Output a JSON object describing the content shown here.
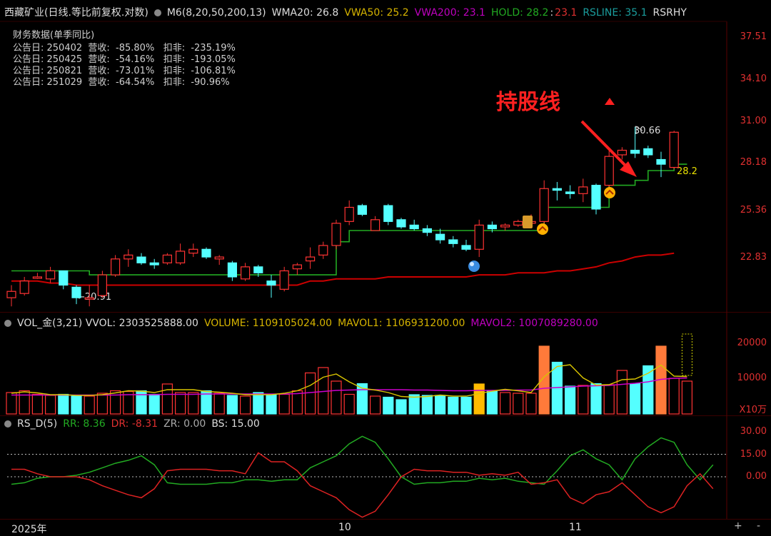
{
  "header": {
    "title": "西藏矿业(日线.等比前复权.对数)",
    "ma_label": "M6(8,20,50,200,13)",
    "wma20": "WMA20: 26.8",
    "vwa50": "VWA50: 25.2",
    "vwa200": "VWA200: 23.1",
    "hold_label": "HOLD: 28.2",
    "hold_sep": ":",
    "hold_low": "23.1",
    "rsline": "RSLINE: 35.1",
    "rsrhy": "RSRHY"
  },
  "financial": {
    "title": "财务数据(单季同比)",
    "rows": [
      "公告日: 250402  营收:  -85.80%   扣非:  -235.19%",
      "公告日: 250425  营收:  -54.16%   扣非:  -193.05%",
      "公告日: 250821  营收:  -73.01%   扣非:  -106.81%",
      "公告日: 251029  营收:  -64.54%   扣非:  -90.96%"
    ]
  },
  "annotation": {
    "text": "持股线",
    "high_label": "30.66",
    "low_label": "←20.91",
    "hold_value": "28.2"
  },
  "price_axis": [
    "37.51",
    "34.10",
    "31.00",
    "28.18",
    "25.36",
    "22.83"
  ],
  "volume": {
    "header": "VOL_金(3,21)  VVOL: 2303525888.00",
    "volume_label": "VOLUME: 1109105024.00",
    "mavol1": "MAVOL1: 1106931200.00",
    "mavol2": "MAVOL2: 1007089280.00",
    "axis": [
      "20000",
      "10000"
    ],
    "unit": "X10万"
  },
  "rs": {
    "header": "RS_D(5)",
    "rr": "RR: 8.36",
    "dr": "DR: -8.31",
    "zr": "ZR: 0.00",
    "bs": "BS: 15.00",
    "axis": [
      "30.00",
      "15.00",
      "0.00"
    ]
  },
  "time_axis": {
    "year": "2025年",
    "m10": "10",
    "m11": "11"
  },
  "controls": {
    "plus": "+",
    "minus": "-"
  },
  "colors": {
    "up": "#ff3333",
    "down": "#54ffff",
    "hold": "#22aa22",
    "vwa200": "#cc0000",
    "mavol2": "#cc00cc",
    "mavol1": "#d9c400",
    "rr": "#22aa22",
    "dr": "#dd2222"
  },
  "chart_data": {
    "type": "candlestick",
    "candles": [
      {
        "o": 20.9,
        "h": 21.5,
        "l": 20.5,
        "c": 21.2,
        "up": true
      },
      {
        "o": 21.1,
        "h": 21.9,
        "l": 21.0,
        "c": 21.7,
        "up": true
      },
      {
        "o": 21.9,
        "h": 22.1,
        "l": 21.8,
        "c": 21.9,
        "up": true
      },
      {
        "o": 21.8,
        "h": 22.4,
        "l": 21.6,
        "c": 22.2,
        "up": true
      },
      {
        "o": 22.2,
        "h": 22.2,
        "l": 21.3,
        "c": 21.5,
        "up": false
      },
      {
        "o": 21.4,
        "h": 21.5,
        "l": 20.6,
        "c": 20.9,
        "up": false
      },
      {
        "o": 20.9,
        "h": 21.5,
        "l": 20.5,
        "c": 20.9,
        "up": true
      },
      {
        "o": 21.0,
        "h": 22.2,
        "l": 20.9,
        "c": 22.0,
        "up": true
      },
      {
        "o": 22.0,
        "h": 23.0,
        "l": 21.9,
        "c": 22.8,
        "up": true
      },
      {
        "o": 22.8,
        "h": 23.3,
        "l": 22.4,
        "c": 23.0,
        "up": true
      },
      {
        "o": 22.9,
        "h": 23.1,
        "l": 22.5,
        "c": 22.6,
        "up": false
      },
      {
        "o": 22.6,
        "h": 22.8,
        "l": 22.3,
        "c": 22.5,
        "up": false
      },
      {
        "o": 22.6,
        "h": 23.1,
        "l": 22.5,
        "c": 23.0,
        "up": true
      },
      {
        "o": 22.6,
        "h": 23.6,
        "l": 22.5,
        "c": 23.2,
        "up": true
      },
      {
        "o": 23.3,
        "h": 23.6,
        "l": 22.9,
        "c": 23.1,
        "up": true
      },
      {
        "o": 23.3,
        "h": 23.4,
        "l": 22.8,
        "c": 22.9,
        "up": false
      },
      {
        "o": 22.8,
        "h": 23.0,
        "l": 22.5,
        "c": 22.9,
        "up": true
      },
      {
        "o": 22.6,
        "h": 22.7,
        "l": 21.7,
        "c": 21.9,
        "up": false
      },
      {
        "o": 21.8,
        "h": 22.6,
        "l": 21.7,
        "c": 22.4,
        "up": true
      },
      {
        "o": 22.4,
        "h": 22.5,
        "l": 21.9,
        "c": 22.1,
        "up": false
      },
      {
        "o": 21.7,
        "h": 22.0,
        "l": 20.9,
        "c": 21.5,
        "up": false
      },
      {
        "o": 21.3,
        "h": 22.4,
        "l": 21.2,
        "c": 22.2,
        "up": true
      },
      {
        "o": 22.3,
        "h": 22.6,
        "l": 22.0,
        "c": 22.5,
        "up": true
      },
      {
        "o": 22.7,
        "h": 23.4,
        "l": 22.3,
        "c": 22.9,
        "up": true
      },
      {
        "o": 23.0,
        "h": 23.7,
        "l": 22.8,
        "c": 23.5,
        "up": true
      },
      {
        "o": 23.5,
        "h": 24.9,
        "l": 23.3,
        "c": 24.7,
        "up": true
      },
      {
        "o": 24.8,
        "h": 26.0,
        "l": 24.6,
        "c": 25.6,
        "up": true
      },
      {
        "o": 25.7,
        "h": 25.8,
        "l": 25.1,
        "c": 25.2,
        "up": false
      },
      {
        "o": 24.3,
        "h": 25.1,
        "l": 24.3,
        "c": 24.9,
        "up": true
      },
      {
        "o": 25.7,
        "h": 25.8,
        "l": 24.6,
        "c": 24.8,
        "up": false
      },
      {
        "o": 24.9,
        "h": 25.0,
        "l": 24.4,
        "c": 24.5,
        "up": false
      },
      {
        "o": 24.6,
        "h": 24.9,
        "l": 24.3,
        "c": 24.4,
        "up": false
      },
      {
        "o": 24.4,
        "h": 24.6,
        "l": 24.0,
        "c": 24.2,
        "up": false
      },
      {
        "o": 24.1,
        "h": 24.4,
        "l": 23.6,
        "c": 23.8,
        "up": false
      },
      {
        "o": 23.8,
        "h": 24.0,
        "l": 23.4,
        "c": 23.6,
        "up": false
      },
      {
        "o": 23.5,
        "h": 23.8,
        "l": 23.2,
        "c": 23.3,
        "up": false
      },
      {
        "o": 23.3,
        "h": 24.9,
        "l": 22.9,
        "c": 24.6,
        "up": true
      },
      {
        "o": 24.4,
        "h": 24.8,
        "l": 24.2,
        "c": 24.6,
        "up": false
      },
      {
        "o": 24.5,
        "h": 24.7,
        "l": 24.3,
        "c": 24.6,
        "up": true
      },
      {
        "o": 24.6,
        "h": 24.9,
        "l": 24.5,
        "c": 24.8,
        "up": true
      },
      {
        "o": 24.8,
        "h": 25.2,
        "l": 24.5,
        "c": 24.7,
        "up": true
      },
      {
        "o": 24.8,
        "h": 27.2,
        "l": 24.6,
        "c": 26.7,
        "up": true
      },
      {
        "o": 26.6,
        "h": 27.1,
        "l": 26.0,
        "c": 26.7,
        "up": false
      },
      {
        "o": 26.4,
        "h": 26.9,
        "l": 26.1,
        "c": 26.5,
        "up": false
      },
      {
        "o": 26.4,
        "h": 27.3,
        "l": 25.9,
        "c": 26.8,
        "up": true
      },
      {
        "o": 26.9,
        "h": 27.0,
        "l": 25.2,
        "c": 25.5,
        "up": false
      },
      {
        "o": 26.9,
        "h": 29.1,
        "l": 26.6,
        "c": 28.7,
        "up": true
      },
      {
        "o": 29.1,
        "h": 29.3,
        "l": 28.5,
        "c": 28.8,
        "up": true
      },
      {
        "o": 28.9,
        "h": 30.66,
        "l": 28.6,
        "c": 29.1,
        "up": false
      },
      {
        "o": 29.2,
        "h": 29.4,
        "l": 28.6,
        "c": 28.8,
        "up": false
      },
      {
        "o": 28.5,
        "h": 29.0,
        "l": 27.4,
        "c": 28.2,
        "up": false
      },
      {
        "o": 28.0,
        "h": 30.4,
        "l": 27.9,
        "c": 30.3,
        "up": true
      }
    ],
    "hold_line": [
      22.2,
      22.2,
      22.2,
      22.2,
      22.2,
      22.2,
      22.0,
      22.0,
      22.0,
      22.0,
      22.0,
      22.0,
      22.0,
      22.0,
      22.0,
      22.0,
      22.0,
      22.0,
      22.0,
      22.0,
      22.0,
      22.0,
      22.0,
      22.0,
      22.0,
      23.7,
      24.3,
      24.3,
      24.3,
      24.3,
      24.3,
      24.3,
      24.3,
      24.3,
      24.3,
      24.3,
      24.3,
      24.3,
      24.3,
      24.3,
      24.3,
      25.6,
      25.6,
      25.6,
      25.6,
      25.6,
      26.9,
      26.9,
      27.2,
      27.8,
      27.8,
      28.2
    ],
    "vwa200": [
      21.7,
      21.7,
      21.7,
      21.6,
      21.6,
      21.5,
      21.5,
      21.5,
      21.5,
      21.5,
      21.5,
      21.5,
      21.5,
      21.5,
      21.5,
      21.5,
      21.5,
      21.5,
      21.5,
      21.5,
      21.5,
      21.5,
      21.5,
      21.7,
      21.7,
      21.8,
      21.8,
      21.8,
      21.8,
      21.9,
      21.9,
      21.9,
      21.9,
      21.9,
      21.9,
      21.9,
      22.0,
      22.0,
      22.0,
      22.1,
      22.1,
      22.1,
      22.2,
      22.2,
      22.3,
      22.4,
      22.6,
      22.7,
      22.9,
      23.0,
      23.0,
      23.1
    ],
    "volume": [
      6000,
      6500,
      5500,
      5200,
      5500,
      5000,
      5000,
      5800,
      6500,
      6300,
      6500,
      5500,
      8400,
      6000,
      6000,
      6500,
      5800,
      5200,
      5000,
      6000,
      5300,
      5500,
      6500,
      11500,
      13000,
      9200,
      5500,
      8500,
      5000,
      4700,
      4000,
      5400,
      5200,
      5200,
      4700,
      4700,
      8400,
      6500,
      6000,
      5800,
      5800,
      19000,
      14500,
      7800,
      8000,
      8500,
      8200,
      12200,
      8500,
      13500,
      19000,
      10000,
      9200
    ],
    "mavol1": [
      5800,
      6200,
      5900,
      5400,
      5400,
      5200,
      5200,
      5400,
      5900,
      6500,
      6400,
      6000,
      6800,
      6800,
      6800,
      6300,
      6100,
      5800,
      5400,
      5400,
      5400,
      5800,
      6500,
      8000,
      10300,
      11200,
      9000,
      7200,
      6700,
      6000,
      4900,
      4700,
      4900,
      5300,
      5000,
      5000,
      5700,
      6400,
      6900,
      6500,
      6000,
      10400,
      13300,
      13800,
      10100,
      8100,
      8200,
      9600,
      9800,
      11400,
      13700,
      10600,
      10500
    ],
    "mavol2": [
      5300,
      5300,
      5300,
      5300,
      5300,
      5300,
      5300,
      5300,
      5300,
      5400,
      5400,
      5400,
      5500,
      5500,
      5500,
      5600,
      5600,
      5600,
      5600,
      5600,
      5600,
      5600,
      5700,
      6000,
      6300,
      6600,
      6700,
      6800,
      6800,
      6800,
      6800,
      6700,
      6700,
      6600,
      6500,
      6500,
      6600,
      6600,
      6600,
      6700,
      6700,
      7200,
      7400,
      7600,
      7800,
      7900,
      8000,
      8300,
      8600,
      9000,
      9700,
      10000,
      10070
    ],
    "rr": [
      -5,
      -4,
      -1,
      0,
      0,
      1,
      3,
      6,
      9,
      11,
      14,
      8,
      -4,
      -5,
      -5,
      -5,
      -4,
      -4,
      -2,
      -2,
      -3,
      -2,
      -2,
      6,
      10,
      14,
      22,
      27,
      23,
      12,
      0,
      -5,
      -4,
      -4,
      -3,
      -3,
      -1,
      -2,
      -1,
      -3,
      -4,
      -5,
      4,
      14,
      18,
      12,
      8,
      -2,
      12,
      20,
      26,
      23,
      8,
      -2,
      8
    ],
    "dr": [
      5,
      5,
      2,
      0,
      0,
      0,
      -2,
      -6,
      -9,
      -12,
      -14,
      -8,
      4,
      5,
      5,
      5,
      4,
      4,
      2,
      16,
      10,
      10,
      4,
      -6,
      -10,
      -14,
      -22,
      -27,
      -23,
      -12,
      0,
      5,
      4,
      4,
      3,
      3,
      1,
      2,
      1,
      3,
      -5,
      -4,
      -2,
      -14,
      -18,
      -12,
      -10,
      -4,
      -12,
      -20,
      -24,
      -20,
      -6,
      2,
      -8
    ]
  }
}
